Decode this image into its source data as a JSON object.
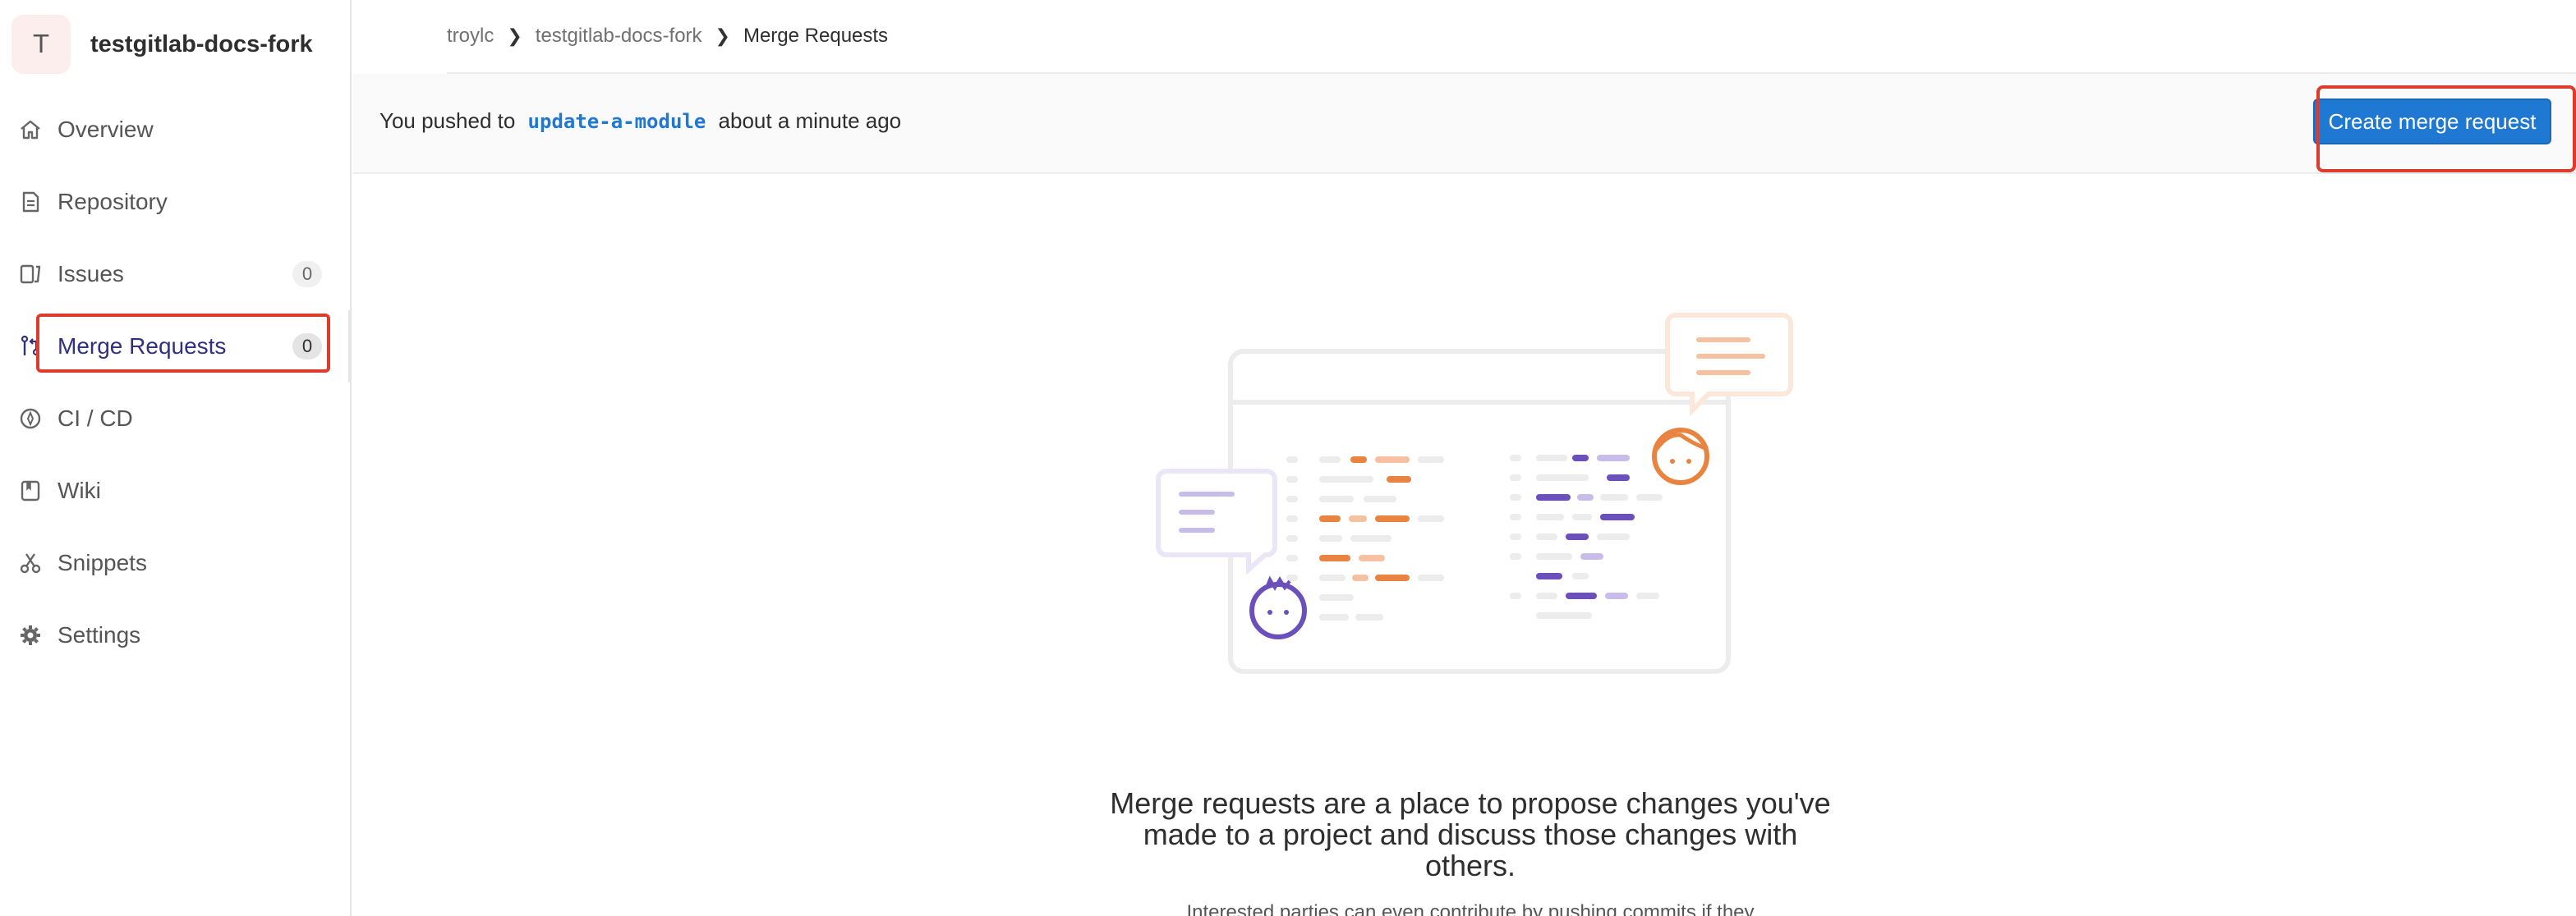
{
  "project": {
    "avatar_letter": "T",
    "name": "testgitlab-docs-fork"
  },
  "sidebar": {
    "items": [
      {
        "label": "Overview"
      },
      {
        "label": "Repository"
      },
      {
        "label": "Issues",
        "count": "0"
      },
      {
        "label": "Merge Requests",
        "count": "0"
      },
      {
        "label": "CI / CD"
      },
      {
        "label": "Wiki"
      },
      {
        "label": "Snippets"
      },
      {
        "label": "Settings"
      }
    ]
  },
  "breadcrumb": {
    "items": [
      "troylc",
      "testgitlab-docs-fork",
      "Merge Requests"
    ]
  },
  "push_banner": {
    "prefix": "You pushed to",
    "branch": "update-a-module",
    "suffix": "about a minute ago",
    "button_label": "Create merge request"
  },
  "empty_state": {
    "title": "Merge requests are a place to propose changes you've made to a project and discuss those changes with others.",
    "subtitle": "Interested parties can even contribute by pushing commits if they"
  },
  "colors": {
    "accent": "#1f78d1",
    "highlight": "#dd3b2b",
    "illustration_orange": "#e8843f",
    "illustration_purple": "#6b4fbb"
  }
}
